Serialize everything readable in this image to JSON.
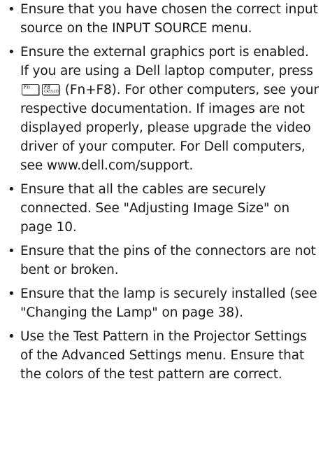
{
  "bullets": [
    "Ensure that you have chosen the correct input source on the INPUT SOURCE menu.",
    "Ensure that all the cables are securely connected. See \"Adjusting Image Size\" on page 10.",
    "Ensure that the pins of the connectors are not bent or broken.",
    "Ensure that the lamp is securely installed (see \"Changing the Lamp\" on page 38).",
    "Use the Test Pattern in the Projector Settings of the Advanced Settings menu. Ensure that the colors of the test pattern are correct."
  ],
  "graphics_item": {
    "before_keys": "Ensure the external graphics port is enabled. If you are using a Dell laptop computer, press ",
    "after_keys": " (Fn+F8). For other computers, see your respective documentation. If images are not displayed properly, please upgrade the video driver of your computer. For Dell computers, see www.dell.com/support."
  },
  "keys": {
    "fn_key": "Fn",
    "f8_key_top": "F8",
    "f8_key_bottom": "CRT/LCD"
  },
  "bullet_symbol": "•"
}
